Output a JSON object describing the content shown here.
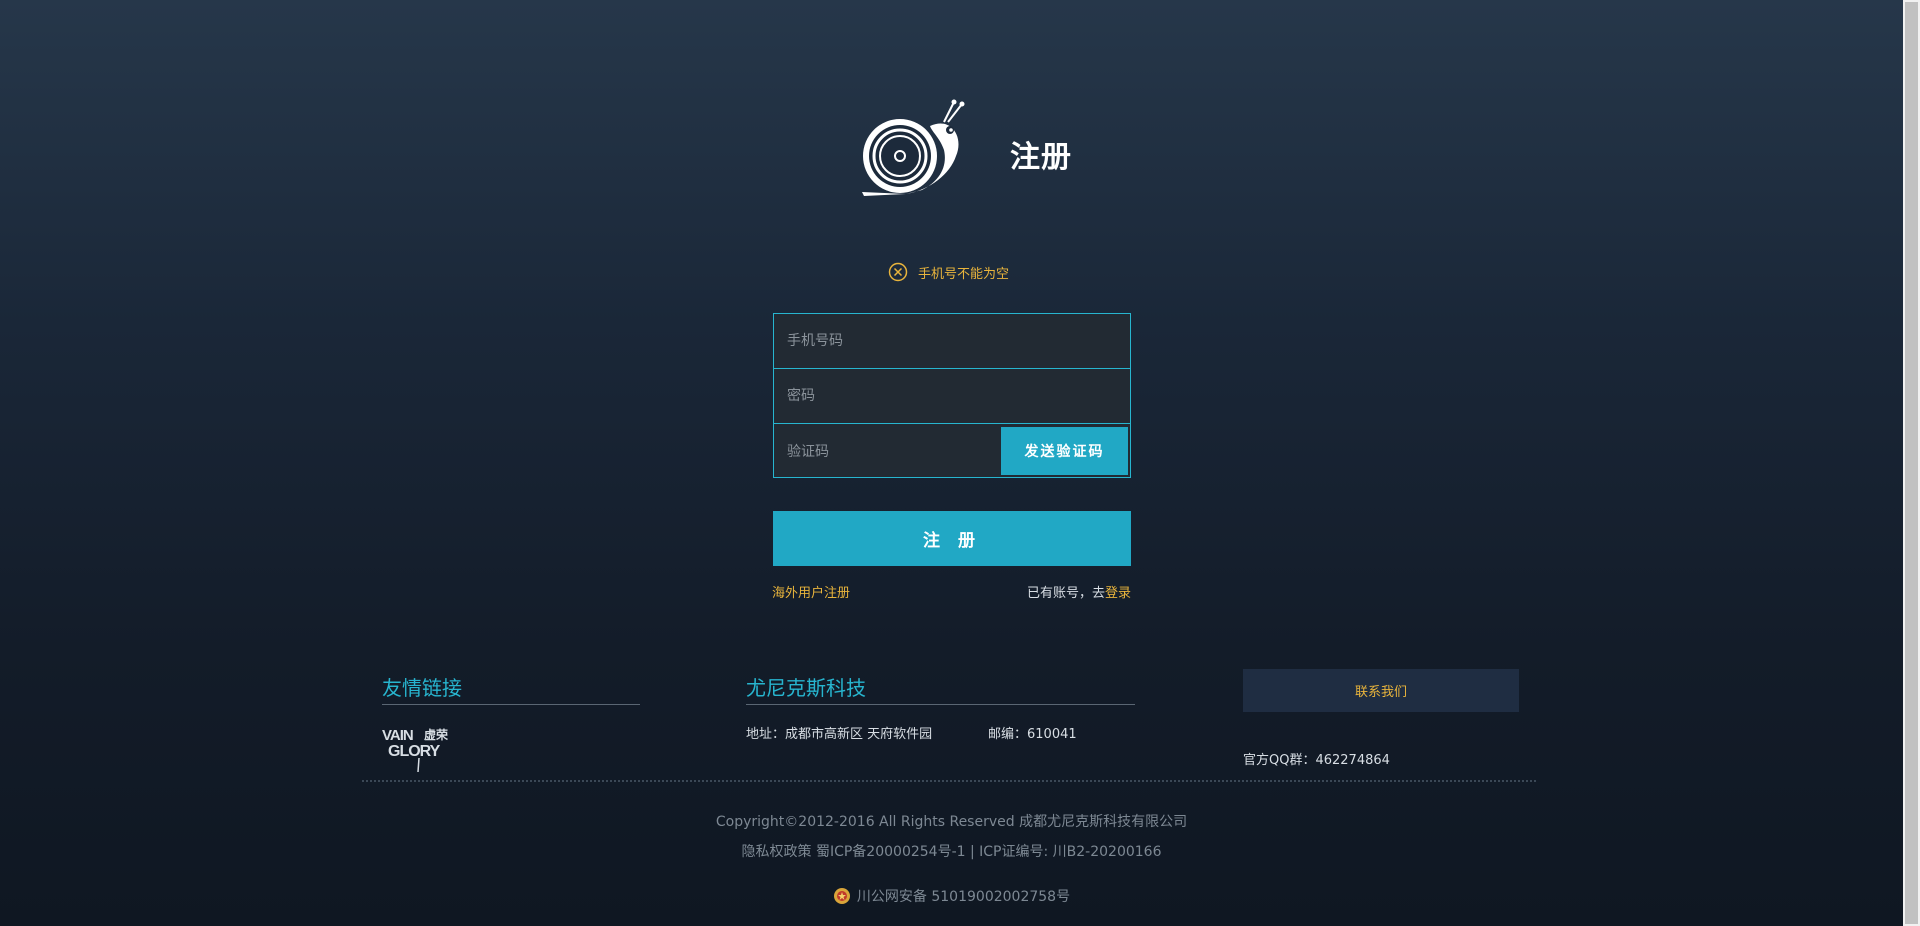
{
  "header": {
    "title": "注册",
    "logo_icon": "snail-logo-icon"
  },
  "error": {
    "icon": "close-circle-icon",
    "message": "手机号不能为空",
    "color": "#e8b43c"
  },
  "form": {
    "phone_placeholder": "手机号码",
    "phone_value": "",
    "password_placeholder": "密码",
    "password_value": "",
    "code_placeholder": "验证码",
    "code_value": "",
    "send_code_label": "发送验证码",
    "submit_label": "注 册",
    "overseas_label": "海外用户注册",
    "have_account_label": "已有账号，去",
    "login_label": "登录",
    "accent_color": "#21a8c5"
  },
  "footer": {
    "links_title": "友情链接",
    "partner_logo": "vainglory-logo",
    "partner_logo_text": [
      "VAIN",
      "GLORY",
      "虚荣"
    ],
    "company_title": "尤尼克斯科技",
    "address": "地址：成都市高新区 天府软件园",
    "postcode": "邮编：610041",
    "contact_label": "联系我们",
    "qq": "官方QQ群：462274864",
    "copyright": "Copyright©2012-2016  All Rights Reserved 成都尤尼克斯科技有限公司",
    "icp": "隐私权政策 蜀ICP备20000254号-1 | ICP证编号: 川B2-20200166",
    "police_icon": "police-badge-icon",
    "police_record": "川公网安备 51019002002758号"
  }
}
